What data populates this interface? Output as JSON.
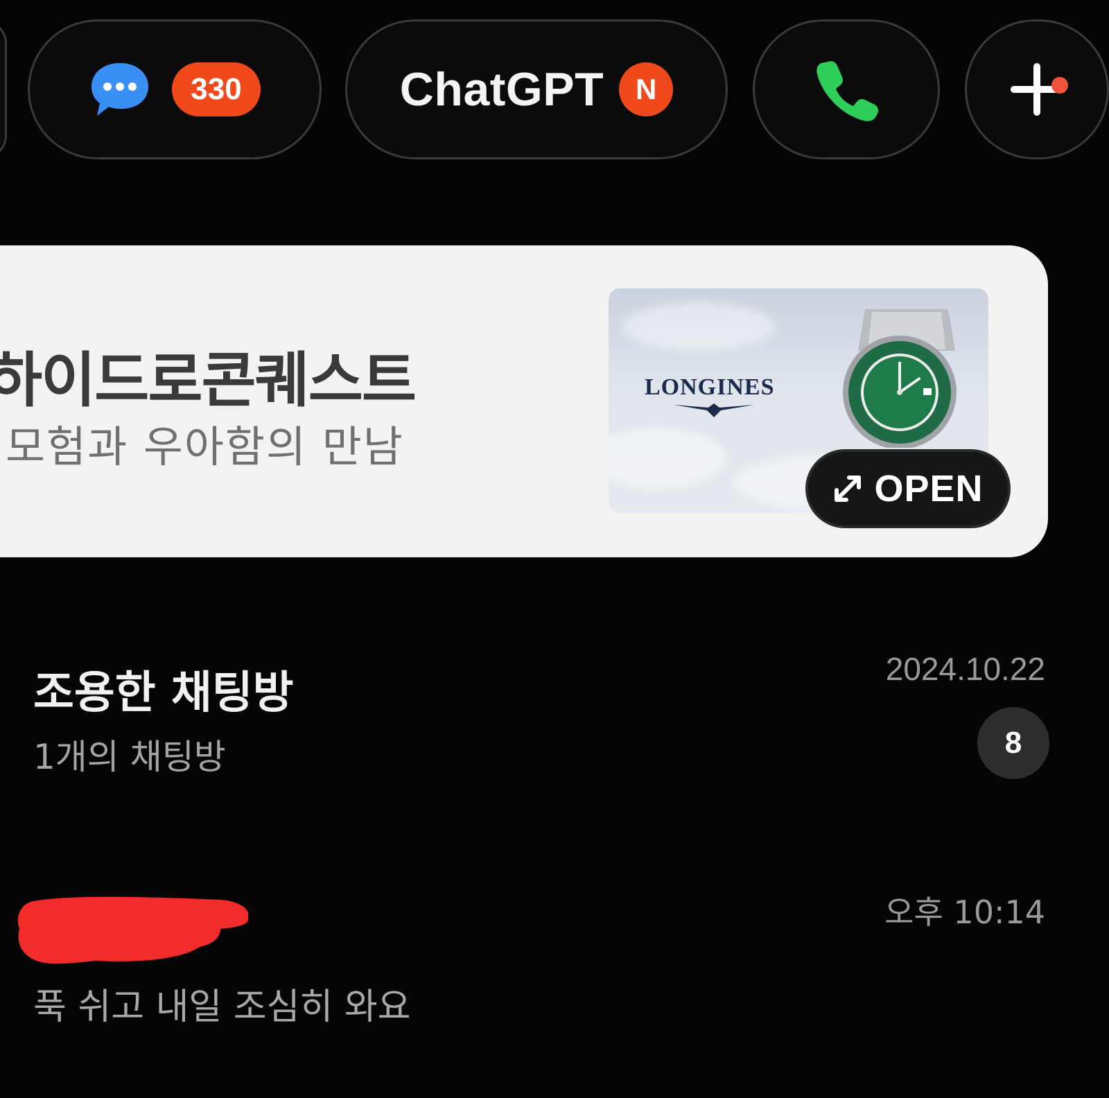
{
  "tabs": {
    "chats_icon": "chat-bubble-icon",
    "chats_count": "330",
    "chatgpt_label": "ChatGPT",
    "chatgpt_badge": "N",
    "call_icon": "phone-icon",
    "add_icon": "plus-icon"
  },
  "ad": {
    "title": "하이드로콘퀘스트",
    "subtitle": "모험과 우아함의 만남",
    "brand": "LONGINES",
    "open_label": "OPEN"
  },
  "chat_list": [
    {
      "title": "조용한 채팅방",
      "subtitle": "1개의 채팅방",
      "time": "2024.10.22",
      "unread": "8"
    },
    {
      "time": "오후 10:14",
      "message": "푹 쉬고 내일 조심히 와요"
    }
  ],
  "colors": {
    "background": "#050505",
    "badge_orange": "#f04a1c",
    "bubble_blue": "#3a8ff5",
    "phone_green": "#2fcf5a",
    "card_bg": "#f3f3f3",
    "redaction_red": "#f22b2b"
  }
}
